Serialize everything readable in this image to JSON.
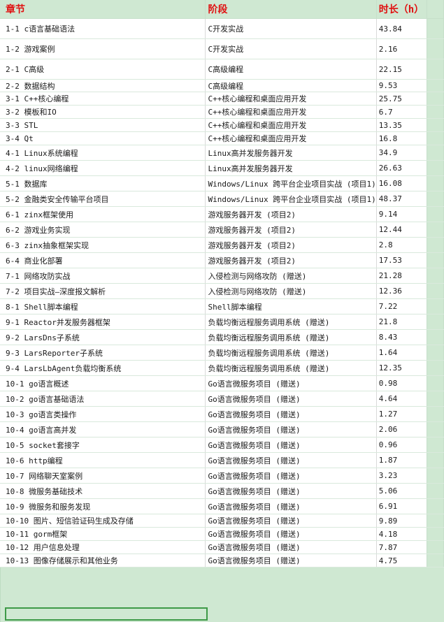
{
  "headers": {
    "chapter": "章节",
    "stage": "阶段",
    "duration": "时长（h）"
  },
  "rows": [
    {
      "chapter": "1-1 c语言基础语法",
      "stage": "C开发实战",
      "duration": "43.84"
    },
    {
      "chapter": "1-2 游戏案例",
      "stage": "C开发实战",
      "duration": "2.16"
    },
    {
      "chapter": "2-1 C高级",
      "stage": "C高级编程",
      "duration": "22.15"
    },
    {
      "chapter": "2-2 数据结构",
      "stage": "C高级编程",
      "duration": "9.53"
    },
    {
      "chapter": "3-1 C++核心编程",
      "stage": "C++核心编程和桌面应用开发",
      "duration": "25.75"
    },
    {
      "chapter": "3-2 模板和IO",
      "stage": "C++核心编程和桌面应用开发",
      "duration": "6.7"
    },
    {
      "chapter": "3-3 STL",
      "stage": "C++核心编程和桌面应用开发",
      "duration": "13.35"
    },
    {
      "chapter": "3-4 Qt",
      "stage": "C++核心编程和桌面应用开发",
      "duration": "16.8"
    },
    {
      "chapter": "4-1 Linux系统编程",
      "stage": "Linux高并发服务器开发",
      "duration": "34.9"
    },
    {
      "chapter": "4-2 linux网络编程",
      "stage": "Linux高并发服务器开发",
      "duration": "26.63"
    },
    {
      "chapter": "5-1 数据库",
      "stage": "Windows/Linux 跨平台企业项目实战 (项目1)",
      "duration": "16.08"
    },
    {
      "chapter": "5-2 金融类安全传输平台项目",
      "stage": "Windows/Linux 跨平台企业项目实战 (项目1)",
      "duration": "48.37"
    },
    {
      "chapter": "6-1 zinx框架使用",
      "stage": "游戏服务器开发 (项目2)",
      "duration": "9.14"
    },
    {
      "chapter": "6-2 游戏业务实现",
      "stage": "游戏服务器开发 (项目2)",
      "duration": "12.44"
    },
    {
      "chapter": "6-3 zinx抽象框架实现",
      "stage": "游戏服务器开发 (项目2)",
      "duration": "2.8"
    },
    {
      "chapter": "6-4 商业化部署",
      "stage": "游戏服务器开发 (项目2)",
      "duration": "17.53"
    },
    {
      "chapter": "7-1 网络攻防实战",
      "stage": "入侵检测与网络攻防 (赠送)",
      "duration": "21.28"
    },
    {
      "chapter": "7-2 项目实战—深度报文解析",
      "stage": "入侵检测与网络攻防 (赠送)",
      "duration": "12.36"
    },
    {
      "chapter": "8-1 Shell脚本编程",
      "stage": "Shell脚本编程",
      "duration": "7.22"
    },
    {
      "chapter": "9-1 Reactor并发服务器框架",
      "stage": "负载均衡远程服务调用系统 (赠送)",
      "duration": "21.8"
    },
    {
      "chapter": "9-2 LarsDns子系统",
      "stage": "负载均衡远程服务调用系统 (赠送)",
      "duration": "8.43"
    },
    {
      "chapter": "9-3 LarsReporter子系统",
      "stage": "负载均衡远程服务调用系统 (赠送)",
      "duration": "1.64"
    },
    {
      "chapter": "9-4 LarsLbAgent负载均衡系统",
      "stage": "负载均衡远程服务调用系统 (赠送)",
      "duration": "12.35"
    },
    {
      "chapter": "10-1 go语言概述",
      "stage": "Go语言微服务项目 (赠送)",
      "duration": "0.98"
    },
    {
      "chapter": "10-2 go语言基础语法",
      "stage": "Go语言微服务项目 (赠送)",
      "duration": "4.64"
    },
    {
      "chapter": "10-3 go语言类操作",
      "stage": "Go语言微服务项目 (赠送)",
      "duration": "1.27"
    },
    {
      "chapter": "10-4 go语言高并发",
      "stage": "Go语言微服务项目 (赠送)",
      "duration": "2.06"
    },
    {
      "chapter": "10-5 socket套接字",
      "stage": "Go语言微服务项目 (赠送)",
      "duration": "0.96"
    },
    {
      "chapter": "10-6 http编程",
      "stage": "Go语言微服务项目 (赠送)",
      "duration": "1.87"
    },
    {
      "chapter": "10-7 网络聊天室案例",
      "stage": "Go语言微服务项目 (赠送)",
      "duration": "3.23"
    },
    {
      "chapter": "10-8 微服务基础技术",
      "stage": "Go语言微服务项目 (赠送)",
      "duration": "5.06"
    },
    {
      "chapter": "10-9 微服务和服务发现",
      "stage": "Go语言微服务项目 (赠送)",
      "duration": "6.91"
    },
    {
      "chapter": "10-10 图片、短信验证码生成及存储",
      "stage": "Go语言微服务项目 (赠送)",
      "duration": "9.89"
    },
    {
      "chapter": "10-11 gorm框架",
      "stage": "Go语言微服务项目 (赠送)",
      "duration": "4.18"
    },
    {
      "chapter": "10-12 用户信息处理",
      "stage": "Go语言微服务项目 (赠送)",
      "duration": "7.87"
    },
    {
      "chapter": "10-13 图像存储展示和其他业务",
      "stage": "Go语言微服务项目 (赠送)",
      "duration": "4.75"
    }
  ]
}
